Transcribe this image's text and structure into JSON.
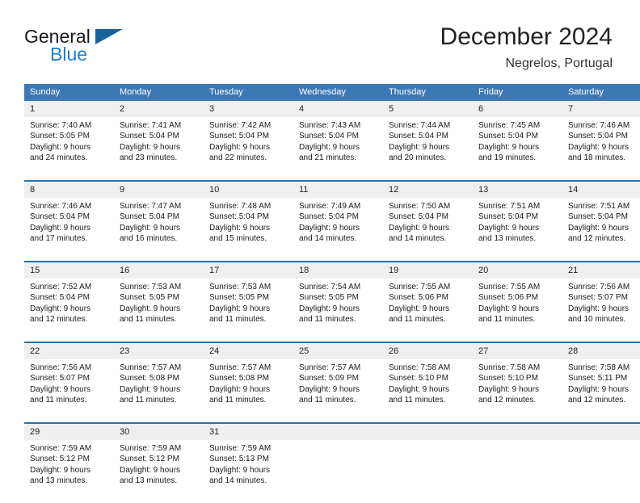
{
  "brand": {
    "line1": "General",
    "line2": "Blue",
    "flag_icon": "triangle-flag-icon"
  },
  "header": {
    "title": "December 2024",
    "subtitle": "Negrelos, Portugal"
  },
  "colors": {
    "header_blue": "#3c78b4",
    "week_rule_blue": "#2f6fad",
    "daynum_bg": "#efefef",
    "brand_blue": "#1c7fd4",
    "flag_blue": "#18639e"
  },
  "calendar": {
    "weekday_headers": [
      "Sunday",
      "Monday",
      "Tuesday",
      "Wednesday",
      "Thursday",
      "Friday",
      "Saturday"
    ],
    "weeks": [
      {
        "daynums": [
          "1",
          "2",
          "3",
          "4",
          "5",
          "6",
          "7"
        ],
        "cells": [
          {
            "l1": "Sunrise: 7:40 AM",
            "l2": "Sunset: 5:05 PM",
            "l3": "Daylight: 9 hours",
            "l4": "and 24 minutes."
          },
          {
            "l1": "Sunrise: 7:41 AM",
            "l2": "Sunset: 5:04 PM",
            "l3": "Daylight: 9 hours",
            "l4": "and 23 minutes."
          },
          {
            "l1": "Sunrise: 7:42 AM",
            "l2": "Sunset: 5:04 PM",
            "l3": "Daylight: 9 hours",
            "l4": "and 22 minutes."
          },
          {
            "l1": "Sunrise: 7:43 AM",
            "l2": "Sunset: 5:04 PM",
            "l3": "Daylight: 9 hours",
            "l4": "and 21 minutes."
          },
          {
            "l1": "Sunrise: 7:44 AM",
            "l2": "Sunset: 5:04 PM",
            "l3": "Daylight: 9 hours",
            "l4": "and 20 minutes."
          },
          {
            "l1": "Sunrise: 7:45 AM",
            "l2": "Sunset: 5:04 PM",
            "l3": "Daylight: 9 hours",
            "l4": "and 19 minutes."
          },
          {
            "l1": "Sunrise: 7:46 AM",
            "l2": "Sunset: 5:04 PM",
            "l3": "Daylight: 9 hours",
            "l4": "and 18 minutes."
          }
        ]
      },
      {
        "daynums": [
          "8",
          "9",
          "10",
          "11",
          "12",
          "13",
          "14"
        ],
        "cells": [
          {
            "l1": "Sunrise: 7:46 AM",
            "l2": "Sunset: 5:04 PM",
            "l3": "Daylight: 9 hours",
            "l4": "and 17 minutes."
          },
          {
            "l1": "Sunrise: 7:47 AM",
            "l2": "Sunset: 5:04 PM",
            "l3": "Daylight: 9 hours",
            "l4": "and 16 minutes."
          },
          {
            "l1": "Sunrise: 7:48 AM",
            "l2": "Sunset: 5:04 PM",
            "l3": "Daylight: 9 hours",
            "l4": "and 15 minutes."
          },
          {
            "l1": "Sunrise: 7:49 AM",
            "l2": "Sunset: 5:04 PM",
            "l3": "Daylight: 9 hours",
            "l4": "and 14 minutes."
          },
          {
            "l1": "Sunrise: 7:50 AM",
            "l2": "Sunset: 5:04 PM",
            "l3": "Daylight: 9 hours",
            "l4": "and 14 minutes."
          },
          {
            "l1": "Sunrise: 7:51 AM",
            "l2": "Sunset: 5:04 PM",
            "l3": "Daylight: 9 hours",
            "l4": "and 13 minutes."
          },
          {
            "l1": "Sunrise: 7:51 AM",
            "l2": "Sunset: 5:04 PM",
            "l3": "Daylight: 9 hours",
            "l4": "and 12 minutes."
          }
        ]
      },
      {
        "daynums": [
          "15",
          "16",
          "17",
          "18",
          "19",
          "20",
          "21"
        ],
        "cells": [
          {
            "l1": "Sunrise: 7:52 AM",
            "l2": "Sunset: 5:04 PM",
            "l3": "Daylight: 9 hours",
            "l4": "and 12 minutes."
          },
          {
            "l1": "Sunrise: 7:53 AM",
            "l2": "Sunset: 5:05 PM",
            "l3": "Daylight: 9 hours",
            "l4": "and 11 minutes."
          },
          {
            "l1": "Sunrise: 7:53 AM",
            "l2": "Sunset: 5:05 PM",
            "l3": "Daylight: 9 hours",
            "l4": "and 11 minutes."
          },
          {
            "l1": "Sunrise: 7:54 AM",
            "l2": "Sunset: 5:05 PM",
            "l3": "Daylight: 9 hours",
            "l4": "and 11 minutes."
          },
          {
            "l1": "Sunrise: 7:55 AM",
            "l2": "Sunset: 5:06 PM",
            "l3": "Daylight: 9 hours",
            "l4": "and 11 minutes."
          },
          {
            "l1": "Sunrise: 7:55 AM",
            "l2": "Sunset: 5:06 PM",
            "l3": "Daylight: 9 hours",
            "l4": "and 11 minutes."
          },
          {
            "l1": "Sunrise: 7:56 AM",
            "l2": "Sunset: 5:07 PM",
            "l3": "Daylight: 9 hours",
            "l4": "and 10 minutes."
          }
        ]
      },
      {
        "daynums": [
          "22",
          "23",
          "24",
          "25",
          "26",
          "27",
          "28"
        ],
        "cells": [
          {
            "l1": "Sunrise: 7:56 AM",
            "l2": "Sunset: 5:07 PM",
            "l3": "Daylight: 9 hours",
            "l4": "and 11 minutes."
          },
          {
            "l1": "Sunrise: 7:57 AM",
            "l2": "Sunset: 5:08 PM",
            "l3": "Daylight: 9 hours",
            "l4": "and 11 minutes."
          },
          {
            "l1": "Sunrise: 7:57 AM",
            "l2": "Sunset: 5:08 PM",
            "l3": "Daylight: 9 hours",
            "l4": "and 11 minutes."
          },
          {
            "l1": "Sunrise: 7:57 AM",
            "l2": "Sunset: 5:09 PM",
            "l3": "Daylight: 9 hours",
            "l4": "and 11 minutes."
          },
          {
            "l1": "Sunrise: 7:58 AM",
            "l2": "Sunset: 5:10 PM",
            "l3": "Daylight: 9 hours",
            "l4": "and 11 minutes."
          },
          {
            "l1": "Sunrise: 7:58 AM",
            "l2": "Sunset: 5:10 PM",
            "l3": "Daylight: 9 hours",
            "l4": "and 12 minutes."
          },
          {
            "l1": "Sunrise: 7:58 AM",
            "l2": "Sunset: 5:11 PM",
            "l3": "Daylight: 9 hours",
            "l4": "and 12 minutes."
          }
        ]
      },
      {
        "daynums": [
          "29",
          "30",
          "31",
          "",
          "",
          "",
          ""
        ],
        "cells": [
          {
            "l1": "Sunrise: 7:59 AM",
            "l2": "Sunset: 5:12 PM",
            "l3": "Daylight: 9 hours",
            "l4": "and 13 minutes."
          },
          {
            "l1": "Sunrise: 7:59 AM",
            "l2": "Sunset: 5:12 PM",
            "l3": "Daylight: 9 hours",
            "l4": "and 13 minutes."
          },
          {
            "l1": "Sunrise: 7:59 AM",
            "l2": "Sunset: 5:13 PM",
            "l3": "Daylight: 9 hours",
            "l4": "and 14 minutes."
          },
          {
            "l1": "",
            "l2": "",
            "l3": "",
            "l4": ""
          },
          {
            "l1": "",
            "l2": "",
            "l3": "",
            "l4": ""
          },
          {
            "l1": "",
            "l2": "",
            "l3": "",
            "l4": ""
          },
          {
            "l1": "",
            "l2": "",
            "l3": "",
            "l4": ""
          }
        ]
      }
    ]
  }
}
